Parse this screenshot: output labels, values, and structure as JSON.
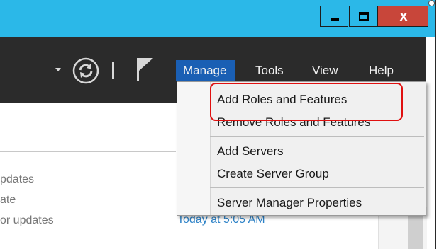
{
  "window": {
    "caption_buttons": {
      "minimize_icon": "minimize-icon",
      "maximize_icon": "maximize-icon",
      "close_icon": "close-icon",
      "close_glyph": "x"
    }
  },
  "toolbar": {
    "icons": [
      "chevron-down-icon",
      "refresh-icon",
      "flag-icon"
    ],
    "menu": {
      "manage": "Manage",
      "tools": "Tools",
      "view": "View",
      "help": "Help"
    }
  },
  "manage_menu": {
    "items": [
      "Add Roles and Features",
      "Remove Roles and Features",
      "Add Servers",
      "Create Server Group",
      "Server Manager Properties"
    ]
  },
  "content": {
    "left_lines": [
      "pdates",
      "ate",
      "or updates"
    ],
    "last_checked": "Today at 5:05 AM"
  },
  "colors": {
    "title_bar": "#2bb8e8",
    "close_button": "#c8463a",
    "toolbar": "#2b2b2b",
    "menu_active": "#1a5fb4",
    "highlight": "#e01010",
    "link": "#2e83c8"
  }
}
